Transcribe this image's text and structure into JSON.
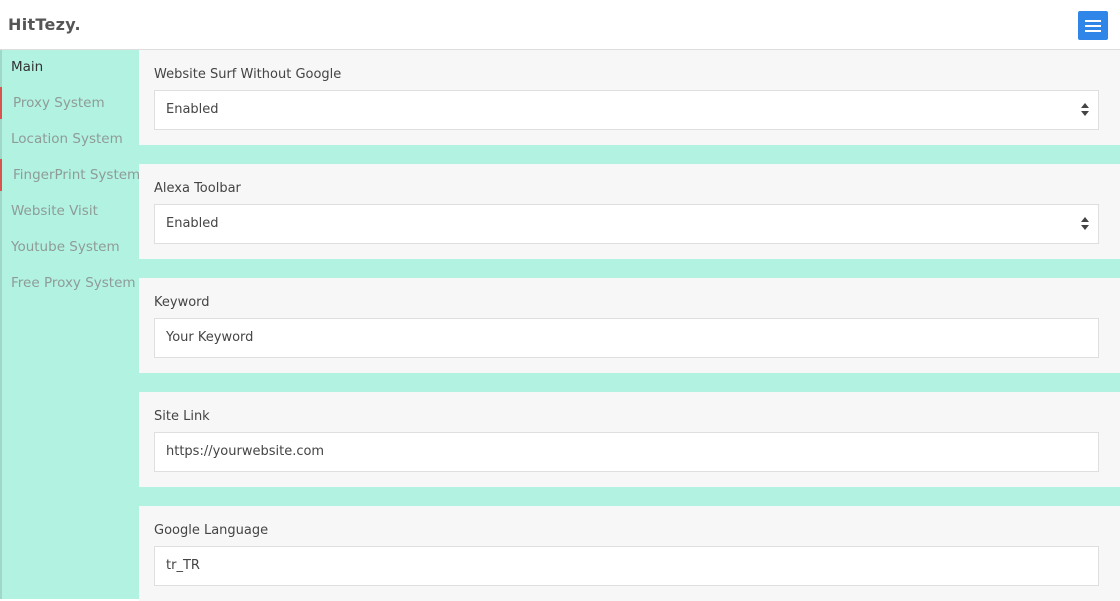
{
  "app": {
    "brand": "HitTezy."
  },
  "sidebar": {
    "items": [
      {
        "label": "Main"
      },
      {
        "label": "Proxy System"
      },
      {
        "label": "Location System"
      },
      {
        "label": "FingerPrint System"
      },
      {
        "label": "Website Visit"
      },
      {
        "label": "Youtube System"
      },
      {
        "label": "Free Proxy System"
      }
    ]
  },
  "form": {
    "surf_without_google": {
      "label": "Website Surf Without Google",
      "value": "Enabled"
    },
    "alexa_toolbar": {
      "label": "Alexa Toolbar",
      "value": "Enabled"
    },
    "keyword": {
      "label": "Keyword",
      "value": "Your Keyword"
    },
    "site_link": {
      "label": "Site Link",
      "value": "https://yourwebsite.com"
    },
    "google_language": {
      "label": "Google Language",
      "value": "tr_TR"
    }
  },
  "colors": {
    "accent": "#2f86e8",
    "sidebar_bg": "#b2f2e1",
    "marker": "#d9534f"
  },
  "icons": {
    "menu": "hamburger-icon",
    "select": "sort-arrows-icon"
  }
}
